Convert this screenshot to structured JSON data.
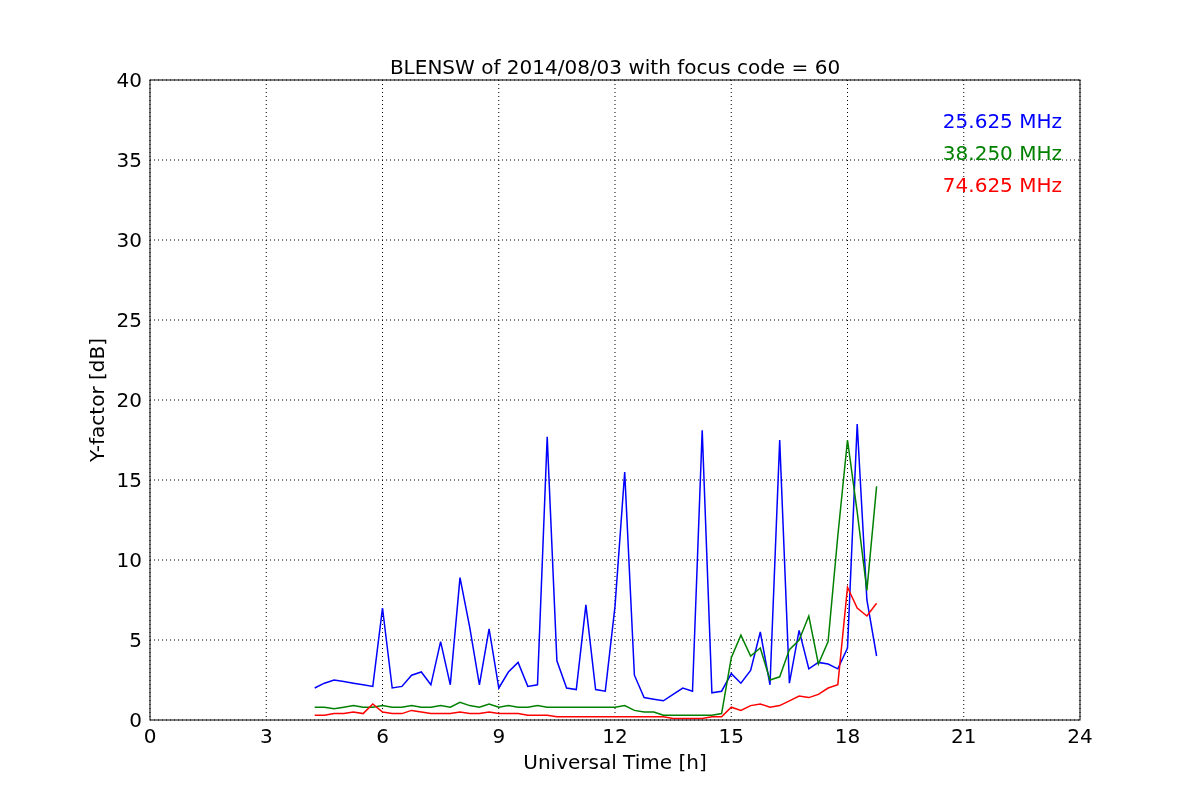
{
  "chart_data": {
    "type": "line",
    "title": "BLENSW of 2014/08/03 with focus code = 60",
    "xlabel": "Universal Time [h]",
    "ylabel": "Y-factor [dB]",
    "xlim": [
      0,
      24
    ],
    "ylim": [
      0,
      40
    ],
    "xticks": [
      0,
      3,
      6,
      9,
      12,
      15,
      18,
      21,
      24
    ],
    "yticks": [
      0,
      5,
      10,
      15,
      20,
      25,
      30,
      35,
      40
    ],
    "grid": true,
    "x": [
      4.25,
      4.5,
      4.75,
      5.0,
      5.25,
      5.5,
      5.75,
      6.0,
      6.25,
      6.5,
      6.75,
      7.0,
      7.25,
      7.5,
      7.75,
      8.0,
      8.25,
      8.5,
      8.75,
      9.0,
      9.25,
      9.5,
      9.75,
      10.0,
      10.25,
      10.5,
      10.75,
      11.0,
      11.25,
      11.5,
      11.75,
      12.0,
      12.25,
      12.5,
      12.75,
      13.0,
      13.25,
      13.5,
      13.75,
      14.0,
      14.25,
      14.5,
      14.75,
      15.0,
      15.25,
      15.5,
      15.75,
      16.0,
      16.25,
      16.5,
      16.75,
      17.0,
      17.25,
      17.5,
      17.75,
      18.0,
      18.25,
      18.5,
      18.75
    ],
    "series": [
      {
        "name": "25.625 MHz",
        "color": "#0000ff",
        "values": [
          2.0,
          2.3,
          2.5,
          2.4,
          2.3,
          2.2,
          2.1,
          7.0,
          2.0,
          2.1,
          2.8,
          3.0,
          2.2,
          4.9,
          2.2,
          8.9,
          5.8,
          2.2,
          5.7,
          2.0,
          3.0,
          3.6,
          2.1,
          2.2,
          17.7,
          3.7,
          2.0,
          1.9,
          7.2,
          1.9,
          1.8,
          7.1,
          15.5,
          2.8,
          1.4,
          1.3,
          1.2,
          1.6,
          2.0,
          1.8,
          18.1,
          1.7,
          1.8,
          2.9,
          2.3,
          3.1,
          5.5,
          2.2,
          17.5,
          2.3,
          5.6,
          3.2,
          3.6,
          3.5,
          3.2,
          4.5,
          18.5,
          7.5,
          4.0
        ]
      },
      {
        "name": "38.250 MHz",
        "color": "#008000",
        "values": [
          0.8,
          0.8,
          0.7,
          0.8,
          0.9,
          0.8,
          0.8,
          0.9,
          0.8,
          0.8,
          0.9,
          0.8,
          0.8,
          0.9,
          0.8,
          1.1,
          0.9,
          0.8,
          1.0,
          0.8,
          0.9,
          0.8,
          0.8,
          0.9,
          0.8,
          0.8,
          0.8,
          0.8,
          0.8,
          0.8,
          0.8,
          0.8,
          0.9,
          0.6,
          0.5,
          0.5,
          0.3,
          0.3,
          0.3,
          0.3,
          0.3,
          0.3,
          0.4,
          3.9,
          5.3,
          4.0,
          4.5,
          2.5,
          2.7,
          4.4,
          5.0,
          6.5,
          3.5,
          4.9,
          11.5,
          17.5,
          13.0,
          8.1,
          14.6
        ]
      },
      {
        "name": "74.625 MHz",
        "color": "#ff0000",
        "values": [
          0.3,
          0.3,
          0.4,
          0.4,
          0.5,
          0.4,
          1.0,
          0.5,
          0.4,
          0.4,
          0.6,
          0.5,
          0.4,
          0.4,
          0.4,
          0.5,
          0.4,
          0.4,
          0.5,
          0.4,
          0.4,
          0.4,
          0.3,
          0.3,
          0.3,
          0.2,
          0.2,
          0.2,
          0.2,
          0.2,
          0.2,
          0.2,
          0.2,
          0.2,
          0.2,
          0.2,
          0.2,
          0.1,
          0.1,
          0.1,
          0.1,
          0.2,
          0.2,
          0.8,
          0.6,
          0.9,
          1.0,
          0.8,
          0.9,
          1.2,
          1.5,
          1.4,
          1.6,
          2.0,
          2.2,
          8.3,
          7.0,
          6.5,
          7.3
        ]
      }
    ]
  }
}
